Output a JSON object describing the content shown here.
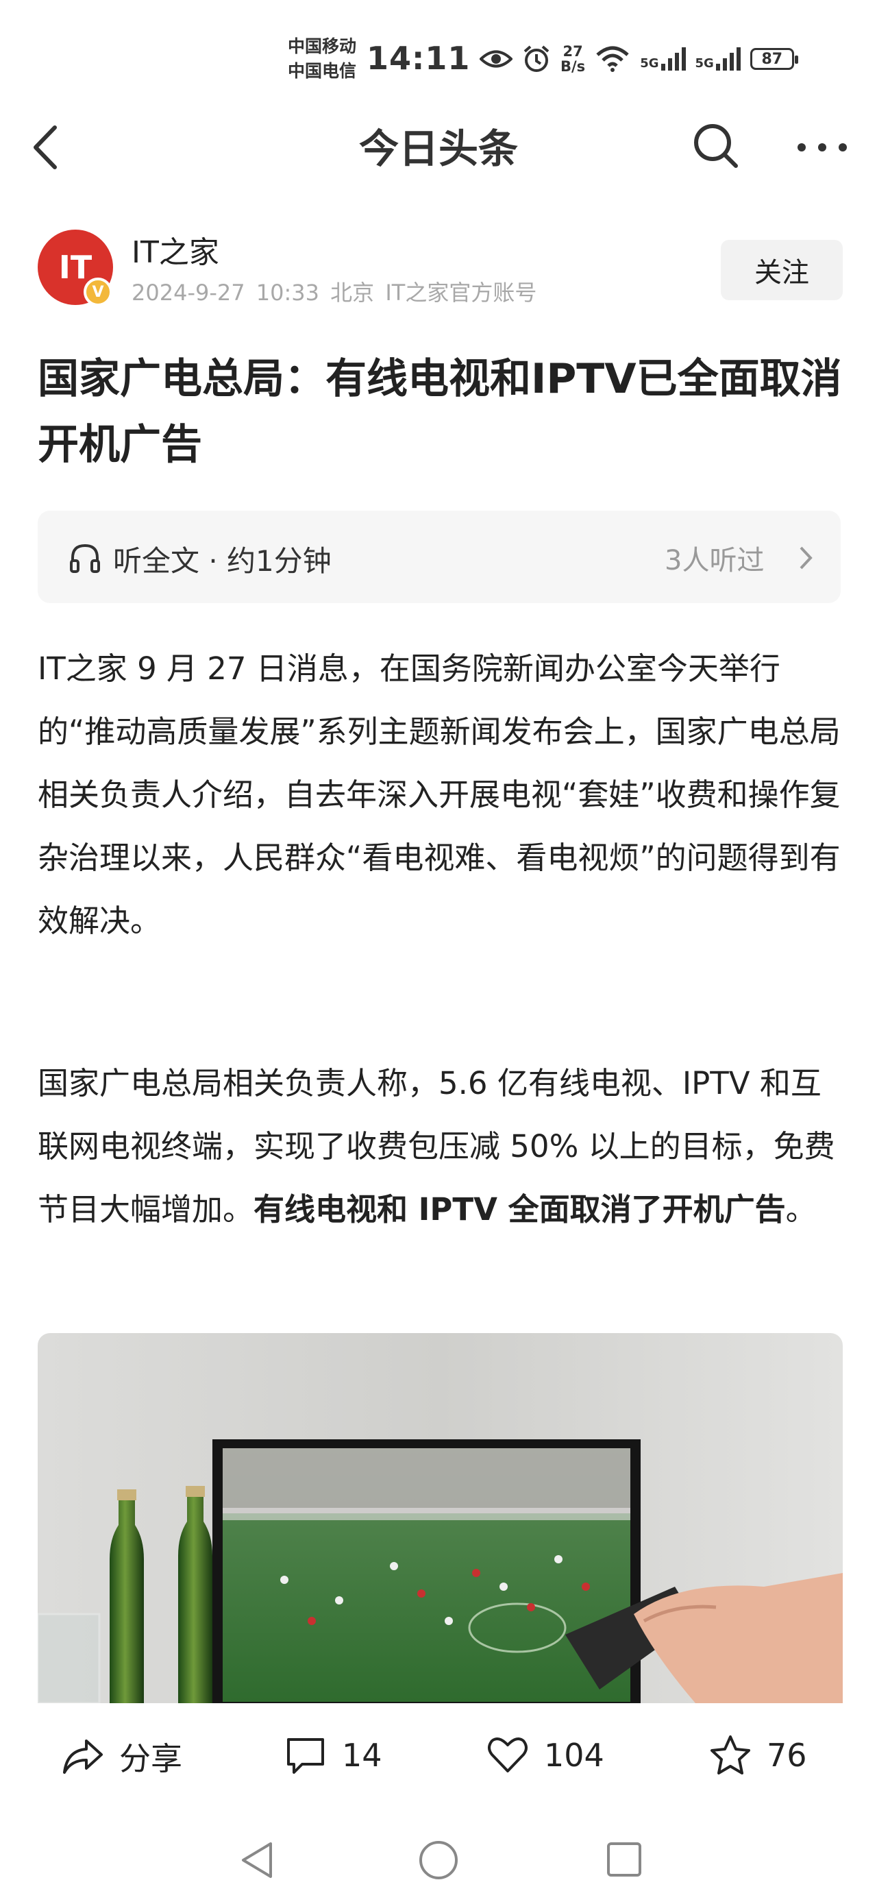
{
  "status_bar": {
    "carrier1": "中国移动",
    "carrier2": "中国电信",
    "time": "14:11",
    "net_speed_value": "27",
    "net_speed_unit": "B/s",
    "sim1_label": "5G",
    "sim2_label": "5G",
    "battery": "87",
    "icons": [
      "eye-icon",
      "alarm-icon",
      "wifi-icon",
      "signal-icon",
      "battery-icon"
    ]
  },
  "nav": {
    "title": "今日头条",
    "icons": [
      "back-icon",
      "search-icon",
      "more-icon"
    ]
  },
  "author": {
    "avatar_text": "IT",
    "verified_badge": "V",
    "name": "IT之家",
    "date": "2024-9-27",
    "time": "10:33",
    "location": "北京",
    "account_type": "IT之家官方账号",
    "follow_label": "关注"
  },
  "article": {
    "title": "国家广电总局：有线电视和IPTV已全面取消开机广告",
    "listen_label": "听全文 · 约1分钟",
    "listen_count": "3人听过",
    "paragraph1": "IT之家 9 月 27 日消息，在国务院新闻办公室今天举行的“推动高质量发展”系列主题新闻发布会上，国家广电总局相关负责人介绍，自去年深入开展电视“套娃”收费和操作复杂治理以来，人民群众“看电视难、看电视烦”的问题得到有效解决。",
    "paragraph2_plain": "国家广电总局相关负责人称，5.6 亿有线电视、IPTV 和互联网电视终端，实现了收费包压减 50% 以上的目标，免费节目大幅增加。",
    "paragraph2_bold": "有线电视和 IPTV 全面取消了开机广告",
    "paragraph2_end": "。"
  },
  "actions": {
    "share_label": "分享",
    "comments": "14",
    "likes": "104",
    "favorites": "76"
  },
  "colors": {
    "avatar_red": "#d9322b",
    "badge_yellow": "#f3b83a",
    "meta_gray": "#a8a8a8"
  }
}
